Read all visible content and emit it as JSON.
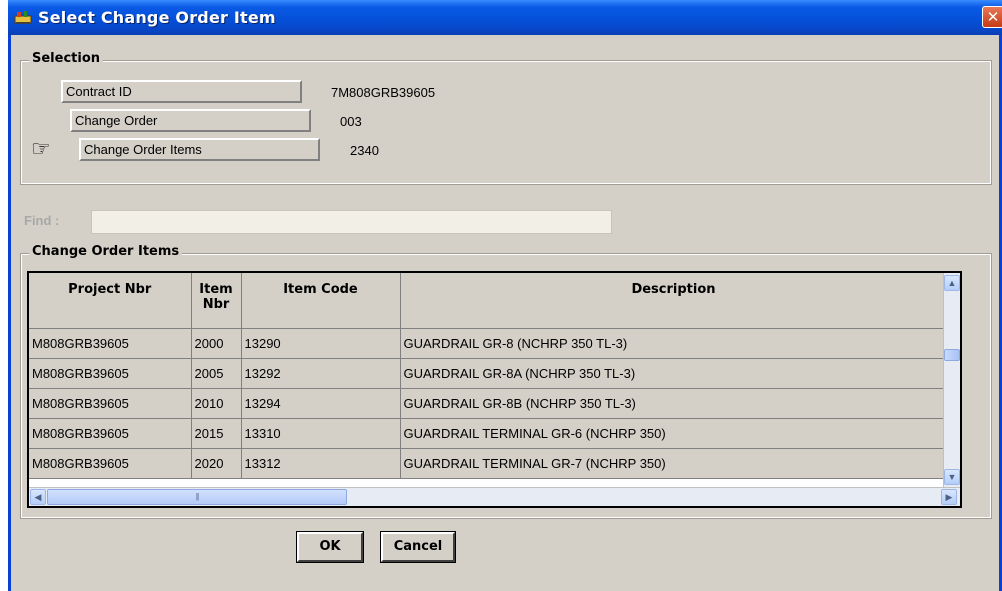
{
  "window": {
    "title": "Select Change Order Item",
    "close_glyph": "✕"
  },
  "selection": {
    "group_label": "Selection",
    "rows": [
      {
        "label": "Contract ID",
        "value": "7M808GRB39605"
      },
      {
        "label": "Change Order",
        "value": "003"
      },
      {
        "label": "Change Order Items",
        "value": "2340"
      }
    ]
  },
  "find": {
    "label": "Find :",
    "value": ""
  },
  "items": {
    "group_label": "Change Order Items",
    "columns": [
      "Project Nbr",
      "Item Nbr",
      "Item Code",
      "Description"
    ],
    "rows": [
      [
        "M808GRB39605",
        "2000",
        "13290",
        "GUARDRAIL GR-8 (NCHRP 350 TL-3)"
      ],
      [
        "M808GRB39605",
        "2005",
        "13292",
        "GUARDRAIL GR-8A (NCHRP 350 TL-3)"
      ],
      [
        "M808GRB39605",
        "2010",
        "13294",
        "GUARDRAIL GR-8B (NCHRP 350 TL-3)"
      ],
      [
        "M808GRB39605",
        "2015",
        "13310",
        "GUARDRAIL TERMINAL GR-6 (NCHRP 350)"
      ],
      [
        "M808GRB39605",
        "2020",
        "13312",
        "GUARDRAIL TERMINAL GR-7 (NCHRP 350)"
      ]
    ]
  },
  "buttons": {
    "ok": "OK",
    "cancel": "Cancel"
  },
  "icons": {
    "pointer": "pointing-hand-icon",
    "app": "app-icon"
  },
  "colors": {
    "titlebar": "#0550d8",
    "dialog": "#d4d0c8",
    "close": "#c43c14"
  }
}
